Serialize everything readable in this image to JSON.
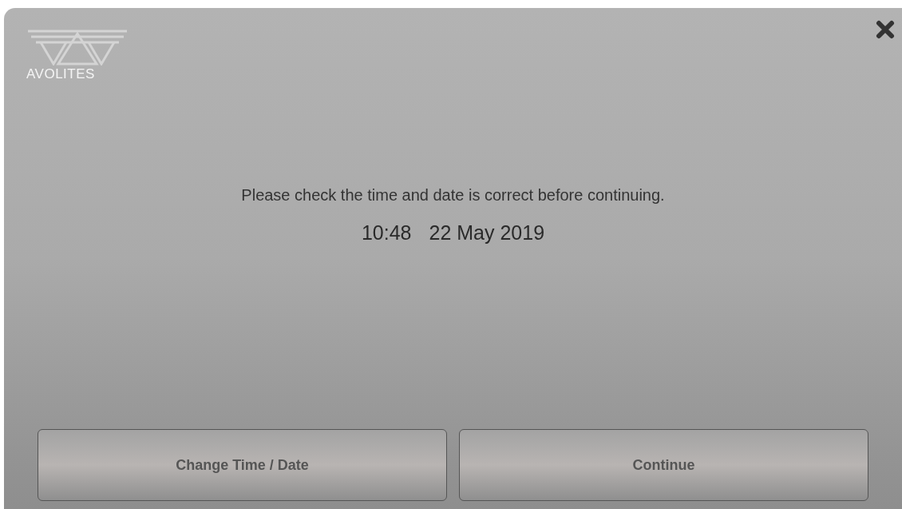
{
  "logo": {
    "wordmark": "AVOLITES"
  },
  "message": "Please check the time and date is correct before continuing.",
  "time": "10:48",
  "date": "22 May 2019",
  "buttons": [
    {
      "label": "Change Time / Date"
    },
    {
      "label": "Continue"
    }
  ]
}
